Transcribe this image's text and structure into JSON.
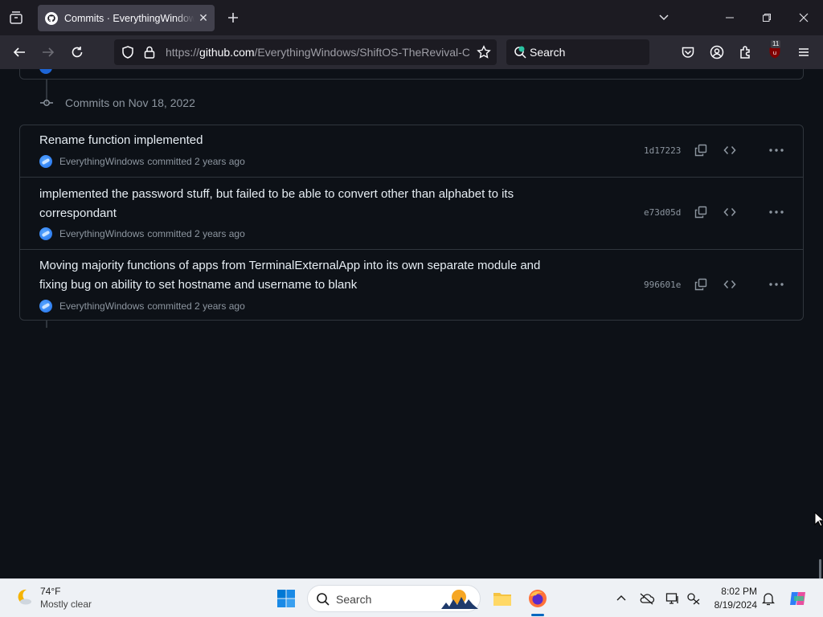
{
  "browser": {
    "tab": {
      "title": "Commits · EverythingWindows/ShiftOS-TheRevival-C"
    },
    "url": {
      "prefix": "https://",
      "host": "github.com",
      "path": "/EverythingWindows/ShiftOS-TheRevival-C"
    },
    "search": {
      "placeholder": "Search"
    },
    "extension_badge": "11"
  },
  "commits": {
    "group_title": "Commits on Nov 18, 2022",
    "rows": [
      {
        "message": "Rename function implemented",
        "author": "EverythingWindows",
        "action": "committed 2 years ago",
        "sha": "1d17223"
      },
      {
        "message": "implemented the password stuff, but failed to be able to convert other than alphabet to its correspondant",
        "author": "EverythingWindows",
        "action": "committed 2 years ago",
        "sha": "e73d05d"
      },
      {
        "message": "Moving majority functions of apps from TerminalExternalApp into its own separate module and fixing bug on ability to set hostname and username to blank",
        "author": "EverythingWindows",
        "action": "committed 2 years ago",
        "sha": "996601e"
      }
    ]
  },
  "taskbar": {
    "weather": {
      "temp": "74°F",
      "condition": "Mostly clear"
    },
    "search": {
      "label": "Search"
    },
    "clock": {
      "time": "8:02 PM",
      "date": "8/19/2024"
    }
  },
  "colors": {
    "page_bg": "#0d1117",
    "border": "#30363d",
    "text": "#e6edf3",
    "muted": "#8d96a0",
    "accent": "#1f6feb"
  }
}
